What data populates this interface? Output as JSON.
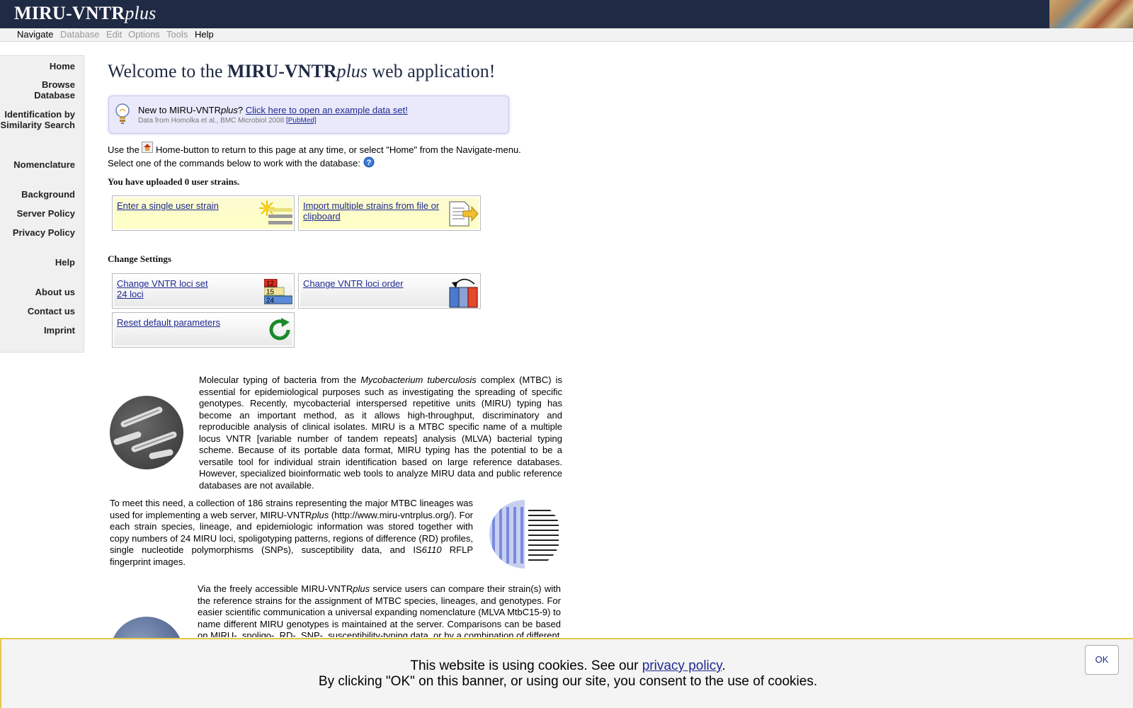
{
  "header": {
    "logo_main": "MIRU-VNTR",
    "logo_italic": "plus"
  },
  "menubar": {
    "items": [
      "Navigate",
      "Database",
      "Edit",
      "Options",
      "Tools",
      "Help"
    ]
  },
  "sidebar": {
    "items": [
      "Home",
      "Browse Database",
      "Identification by Similarity Search",
      "Nomenclature",
      "Background",
      "Server Policy",
      "Privacy Policy",
      "Help",
      "About us",
      "Contact us",
      "Imprint"
    ]
  },
  "main": {
    "title_prefix": "Welcome to the ",
    "title_bold": "MIRU-VNTR",
    "title_italic": "plus",
    "title_suffix": " web application!",
    "tip": {
      "new_prefix": "New to MIRU-VNTR",
      "new_italic": "plus",
      "new_suffix": "? ",
      "example_link": "Click here to open an example data set!",
      "source": "Data from Homolka et al., BMC Microbiol 2008 ",
      "pubmed": "[PubMed]"
    },
    "use_prefix": "Use the ",
    "use_suffix": " Home-button to return to this page at any time, or select \"Home\" from the Navigate-menu.",
    "select_text": "Select one of the commands below to work with the database: ",
    "uploaded": "You have uploaded 0 user strains.",
    "enter_single": "Enter a single user strain",
    "import_multiple": "Import multiple strains from file or clipboard",
    "change_settings": "Change Settings",
    "change_loci_set": "Change VNTR loci set",
    "loci_count": "24 loci",
    "change_loci_order": "Change VNTR loci order",
    "reset_defaults": "Reset default parameters",
    "icon_numbers": [
      "12",
      "15",
      "24"
    ],
    "para1_a": "Molecular typing of bacteria from the ",
    "para1_italic": "Mycobacterium tuberculosis",
    "para1_b": " complex (MTBC) is essential for epidemiological purposes such as investigating the spreading of specific genotypes. Recently, mycobacterial interspersed repetitive units (MIRU) typing has become an important method, as it allows high-throughput, discriminatory and reproducible analysis of clinical isolates. MIRU is a MTBC specific name of a multiple locus VNTR [variable number of tandem repeats] analysis (MLVA) bacterial typing scheme. Because of its portable data format, MIRU typing has the potential to be a versatile tool for individual strain identification based on large reference databases. However, specialized bioinformatic web tools to analyze MIRU data and public reference databases are not available.",
    "para2_a": "To meet this need, a collection of 186 strains representing the major MTBC lineages was used for implementing a web server, MIRU-VNTR",
    "para2_italic": "plus",
    "para2_b": " (http://www.miru-vntrplus.org/). For each strain species, lineage, and epidemiologic information was stored together with copy numbers of 24 MIRU loci, spoligotyping patterns, regions of difference (RD) profiles, single nucleotide polymorphisms (SNPs), susceptibility data, and IS",
    "para2_italic2": "6110",
    "para2_c": " RFLP fingerprint images.",
    "para3_a": "Via the freely accessible MIRU-VNTR",
    "para3_italic": "plus",
    "para3_b": " service users can compare their strain(s) with the reference strains for the assignment of MTBC species, lineages, and genotypes. For easier scientific communication a universal expanding nomenclature (MLVA MtbC15-9) to name different MIRU genotypes is maintained at the server. Comparisons can be based on MIRU-, spoligo-, RD-, SNP-, susceptibility-typing data, or by a combination of different"
  },
  "cookie": {
    "line1_prefix": "This website is using cookies. See our ",
    "privacy_link": "privacy policy",
    "line1_suffix": ".",
    "line2": "By clicking \"OK\" on this banner, or using our site, you consent to the use of cookies.",
    "ok": "OK"
  },
  "colors": {
    "header_bg": "#1f2a44",
    "link": "#1f2a90",
    "tip_bg": "#e9e9fb",
    "cookie_border": "#e6c84c"
  }
}
